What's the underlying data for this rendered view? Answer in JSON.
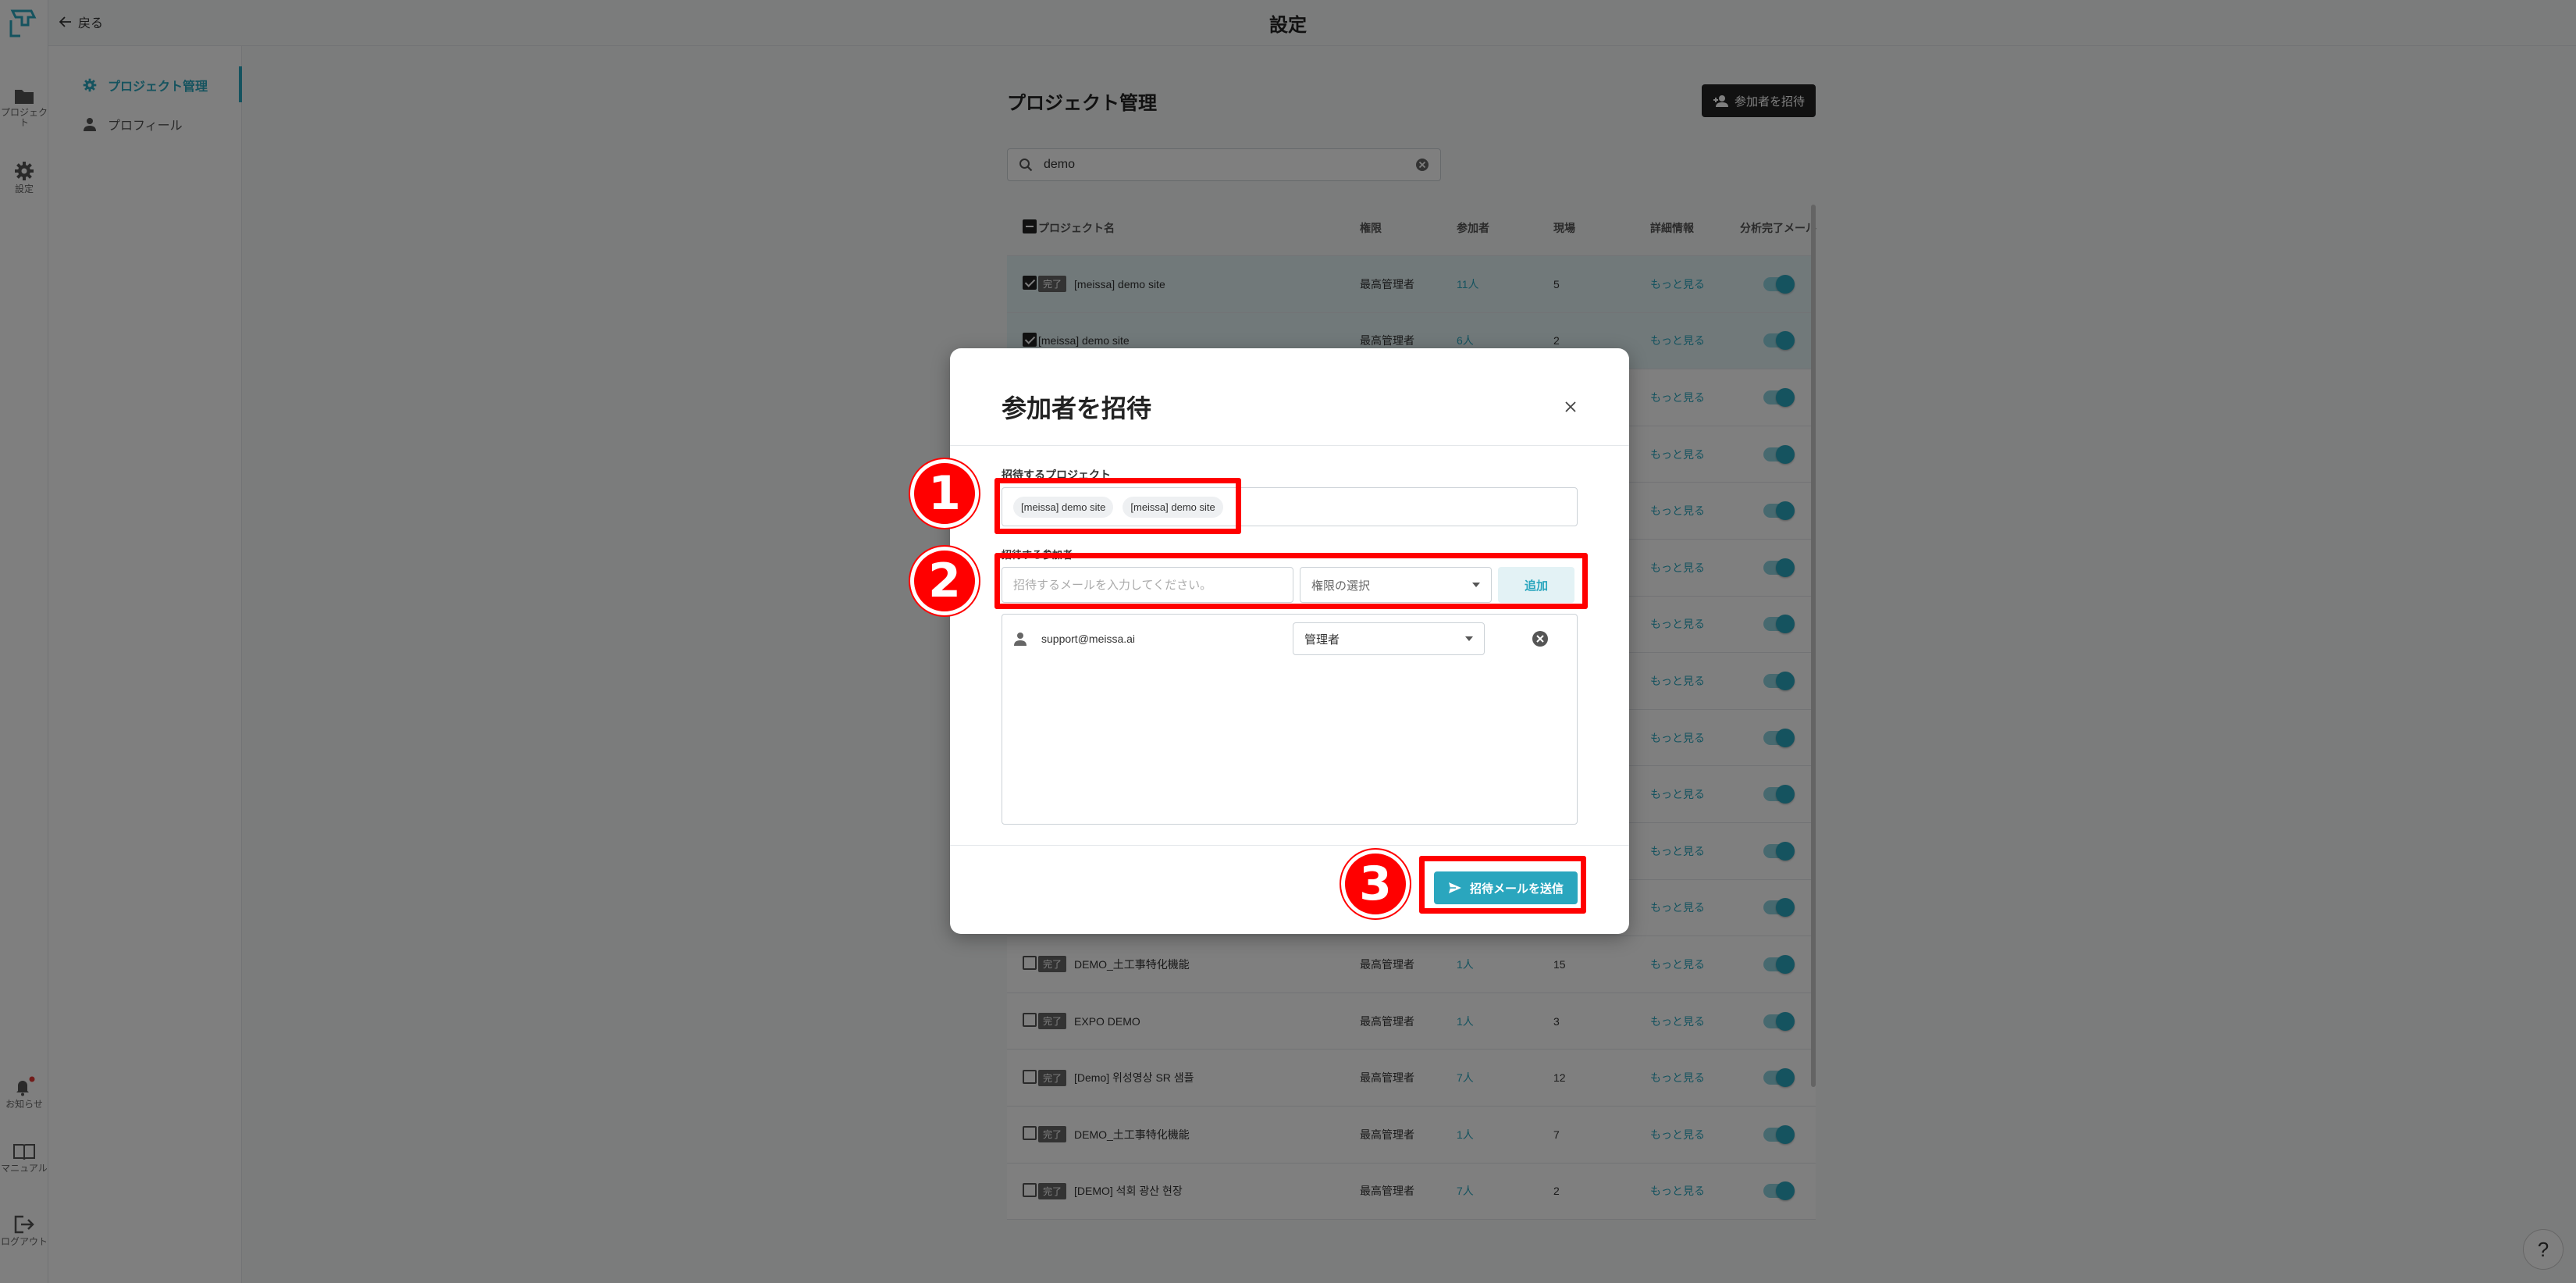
{
  "header": {
    "back_label": "戻る",
    "title": "設定"
  },
  "rail": [
    {
      "label": "プロジェクト",
      "icon": "folder-icon"
    },
    {
      "label": "設定",
      "icon": "gear-icon"
    },
    {
      "label": "お知らせ",
      "icon": "bell-icon"
    },
    {
      "label": "マニュアル",
      "icon": "book-icon"
    },
    {
      "label": "ログアウト",
      "icon": "logout-icon"
    }
  ],
  "subnav": {
    "items": [
      {
        "label": "プロジェクト管理",
        "icon": "gear-icon"
      },
      {
        "label": "プロフィール",
        "icon": "person-icon"
      }
    ]
  },
  "main": {
    "title": "プロジェクト管理",
    "invite_button": "参加者を招待",
    "search_value": "demo",
    "columns": [
      "プロジェクト名",
      "権限",
      "参加者",
      "現場",
      "詳細情報",
      "分析完了メール"
    ],
    "rows": [
      {
        "badge": "完了",
        "name": "[meissa] demo site",
        "role": "最高管理者",
        "participants": "11人",
        "sites": "5",
        "more": "もっと見る",
        "selected": true
      },
      {
        "badge": "",
        "name": "[meissa] demo site",
        "role": "最高管理者",
        "participants": "6人",
        "sites": "2",
        "more": "もっと見る",
        "selected": true
      },
      {
        "badge": "",
        "name": "",
        "role": "",
        "participants": "",
        "sites": "",
        "more": "もっと見る",
        "selected": false
      },
      {
        "badge": "",
        "name": "",
        "role": "",
        "participants": "",
        "sites": "",
        "more": "もっと見る",
        "selected": false
      },
      {
        "badge": "",
        "name": "",
        "role": "",
        "participants": "",
        "sites": "",
        "more": "もっと見る",
        "selected": false
      },
      {
        "badge": "",
        "name": "",
        "role": "",
        "participants": "",
        "sites": "",
        "more": "もっと見る",
        "selected": false
      },
      {
        "badge": "",
        "name": "",
        "role": "",
        "participants": "",
        "sites": "",
        "more": "もっと見る",
        "selected": false
      },
      {
        "badge": "",
        "name": "",
        "role": "",
        "participants": "",
        "sites": "",
        "more": "もっと見る",
        "selected": false
      },
      {
        "badge": "",
        "name": "",
        "role": "",
        "participants": "",
        "sites": "",
        "more": "もっと見る",
        "selected": false
      },
      {
        "badge": "",
        "name": "",
        "role": "",
        "participants": "",
        "sites": "",
        "more": "もっと見る",
        "selected": false
      },
      {
        "badge": "",
        "name": "",
        "role": "",
        "participants": "",
        "sites": "",
        "more": "もっと見る",
        "selected": false
      },
      {
        "badge": "",
        "name": "",
        "role": "",
        "participants": "",
        "sites": "",
        "more": "もっと見る",
        "selected": false
      },
      {
        "badge": "完了",
        "name": "DEMO_土工事特化機能",
        "role": "最高管理者",
        "participants": "1人",
        "sites": "15",
        "more": "もっと見る",
        "selected": false
      },
      {
        "badge": "完了",
        "name": "EXPO DEMO",
        "role": "最高管理者",
        "participants": "1人",
        "sites": "3",
        "more": "もっと見る",
        "selected": false
      },
      {
        "badge": "完了",
        "name": "[Demo] 위성영상 SR 샘플",
        "role": "最高管理者",
        "participants": "7人",
        "sites": "12",
        "more": "もっと見る",
        "selected": false
      },
      {
        "badge": "完了",
        "name": "DEMO_土工事特化機能",
        "role": "最高管理者",
        "participants": "1人",
        "sites": "7",
        "more": "もっと見る",
        "selected": false
      },
      {
        "badge": "完了",
        "name": "[DEMO] 석회 광산 현장",
        "role": "最高管理者",
        "participants": "7人",
        "sites": "2",
        "more": "もっと見る",
        "selected": false
      }
    ]
  },
  "modal": {
    "title": "参加者を招待",
    "projects_label": "招待するプロジェクト",
    "projects": [
      "[meissa] demo site",
      "[meissa] demo site"
    ],
    "invitees_label": "招待する参加者",
    "email_placeholder": "招待するメールを入力してください。",
    "role_placeholder": "権限の選択",
    "add_label": "追加",
    "member": {
      "email": "support@meissa.ai",
      "role": "管理者"
    },
    "send_label": "招待メールを送信"
  },
  "callouts": [
    "1",
    "2",
    "3"
  ],
  "help_label": "?",
  "colors": {
    "accent": "#2aa6be",
    "callout": "#ff0000",
    "dark": "#222222"
  }
}
